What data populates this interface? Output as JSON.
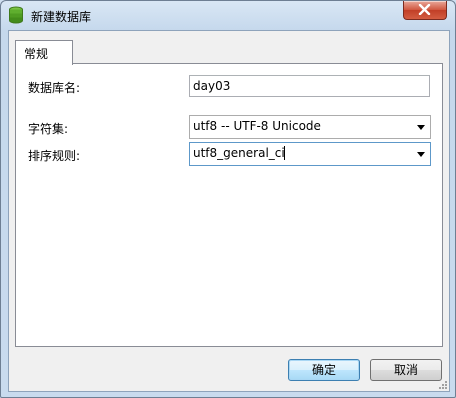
{
  "window": {
    "title": "新建数据库"
  },
  "tabs": [
    {
      "label": "常规"
    }
  ],
  "form": {
    "db_name_label": "数据库名:",
    "db_name_value": "day03",
    "charset_label": "字符集:",
    "charset_value": "utf8 -- UTF-8 Unicode",
    "collation_label": "排序规则:",
    "collation_value": "utf8_general_ci"
  },
  "buttons": {
    "ok": "确定",
    "cancel": "取消"
  },
  "colors": {
    "titlebar": "#c5d8ec",
    "close": "#c13f27",
    "accent": "#3c7fb1"
  }
}
